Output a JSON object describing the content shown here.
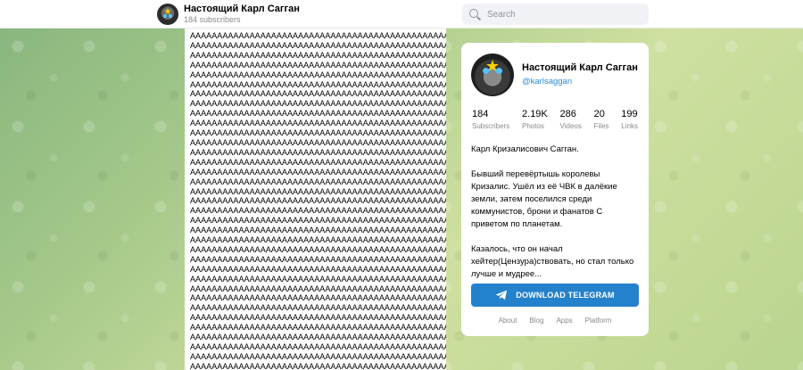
{
  "header": {
    "channel_name": "Настоящий Карл Сагган",
    "subscribers": "184 subscribers",
    "search_placeholder": "Search"
  },
  "messages": {
    "lines": [
      "AAAAAAAAAAAAAAAAAAAAAAAAAAAAAAAAAAAAAAAAAAAAAAAA",
      "AAAAAAAAAAAAAAAAAAAAAAAAAAAAAAAAAAAAAAAAAAAAAAAA",
      "AAAAAAAAAAAAAAAAAAAAAAAAAAAAAAAAAAAAAAAAAAAAAAAA",
      "AAAAAAAAAAAAAAAAAAAAAAAAAAAAAAAAAAAAAAAAAAAAAAAA",
      "AAAAAAAAAAAAAAAAAAAAAAAAAAAAAAAAAAAAAAAAAAAAAAAA",
      "AAAAAAAAAAAAAAAAAAAAAAAAAAAAAAAAAAAAAAAAAAAAAAAA",
      "AAAAAAAAAAAAAAAAAAAAAAAAAAAAAAAAAAAAAAAAAAAAAAAA",
      "AAAAAAAAAAAAAAAAAAAAAAAAAAAAAAAAAAAAAAAAAAAAAAAA",
      "AAAAAAAAAAAAAAAAAAAAAAAAAAAAAAAAAAAAAAAAAAAAAAAA",
      "AAAAAAAAAAAAAAAAAAAAAAAAAAAAAAAAAAAAAAAAAAAAAAAA",
      "AAAAAAAAAAAAAAAAAAAAAAAAAAAAAAAAAAAAAAAAAAAAAAAA",
      "AAAAAAAAAAAAAAAAAAAAAAAAAAAAAAAAAAAAAAAAAAAAAAAA",
      "AAAAAAAAAAAAAAAAAAAAAAAAAAAAAAAAAAAAAAAAAAAAAAAA",
      "AAAAAAAAAAAAAAAAAAAAAAAAAAAAAAAAAAAAAAAAAAAAAAAA",
      "AAAAAAAAAAAAAAAAAAAAAAAAAAAAAAAAAAAAAAAAAAAAAAAA",
      "AAAAAAAAAAAAAAAAAAAAAAAAAAAAAAAAAAAAAAAAAAAAAAAA",
      "AAAAAAAAAAAAAAAAAAAAAAAAAAAAAAAAAAAAAAAAAAAAAAAA",
      "AAAAAAAAAAAAAAAAAAAAAAAAAAAAAAAAAAAAAAAAAAAAAAAA",
      "AAAAAAAAAAAAAAAAAAAAAAAAAAAAAAAAAAAAAAAAAAAAAAAA",
      "AAAAAAAAAAAAAAAAAAAAAAAAAAAAAAAAAAAAAAAAAAAAAAAA",
      "AAAAAAAAAAAAAAAAAAAAAAAAAAAAAAAAAAAAAAAAAAAAAAAA",
      "AAAAAAAAAAAAAAAAAAAAAAAAAAAAAAAAAAAAAAAAAAAAAAAA",
      "AAAAAAAAAAAAAAAAAAAAAAAAAAAAAAAAAAAAAAAAAAAAAAAA",
      "AAAAAAAAAAAAAAAAAAAAAAAAAAAAAAAAAAAAAAAAAAAAAAAA",
      "AAAAAAAAAAAAAAAAAAAAAAAAAAAAAAAAAAAAAAAAAAAAAAAA",
      "AAAAAAAAAAAAAAAAAAAAAAAAAAAAAAAAAAAAAAAAAAAAAAAA",
      "AAAAAAAAAAAAAAAAAAAAAAAAAAAAAAAAAAAAAAAAAAAAAAAA",
      "AAAAAAAAAAAAAAAAAAAAAAAAAAAAAAAAAAAAAAAAAAAAAAAA",
      "AAAAAAAAAAAAAAAAAAAAAAAAAAAAAAAAAAAAAAAAAAAAAAAA",
      "AAAAAAAAAAAAAAAAAAAAAAAAAAAAAAAAAAAAAAAAAAAAAAAA",
      "AAAAAAAAAAAAAAAAAAAAAAAAAAAAAAAAAAAAAAAAAAAAAAAA",
      "AAAAAAAAAAAAAAAAAAAAAAAAAAAAAAAAAAAAAAAAAAAAAAAA",
      "AAAAAAAAAAAAAAAAAAAAAAAAAAAAAAAAAAAAAAAAAAAAAAAA",
      "AAAAAAAAAAAAAAAAAAAAAAAAAAAAAAAAAAAAAAAAAAAAAAAA",
      "AAAAAAAAAAAAAAAAAAAAAAAAAAAAAAAAAAAAAAAAAAAAAAAA"
    ]
  },
  "card": {
    "title": "Настоящий Карл Сагган",
    "handle": "@karlsaggan",
    "stats": [
      {
        "value": "184",
        "label": "Subscribers"
      },
      {
        "value": "2.19K",
        "label": "Photos"
      },
      {
        "value": "286",
        "label": "Videos"
      },
      {
        "value": "20",
        "label": "Files"
      },
      {
        "value": "199",
        "label": "Links"
      }
    ],
    "description": "Карл Кризалисович Сагган.\n\nБывший перевёртышь королевы Кризалис. Ушёл из её ЧВК в далёкие земли, затем поселился среди коммунистов, брони и фанатов С приветом по планетам.\n\nКазалось, что он начал хейтер(Цензура)ствовать, но стал только лучше и мудрее...",
    "download_label": "DOWNLOAD TELEGRAM",
    "footer_links": [
      "About",
      "Blog",
      "Apps",
      "Platform"
    ]
  },
  "colors": {
    "accent": "#2481cc",
    "link": "#2a8bd9"
  },
  "icons": [
    "search-icon",
    "telegram-plane-icon"
  ]
}
